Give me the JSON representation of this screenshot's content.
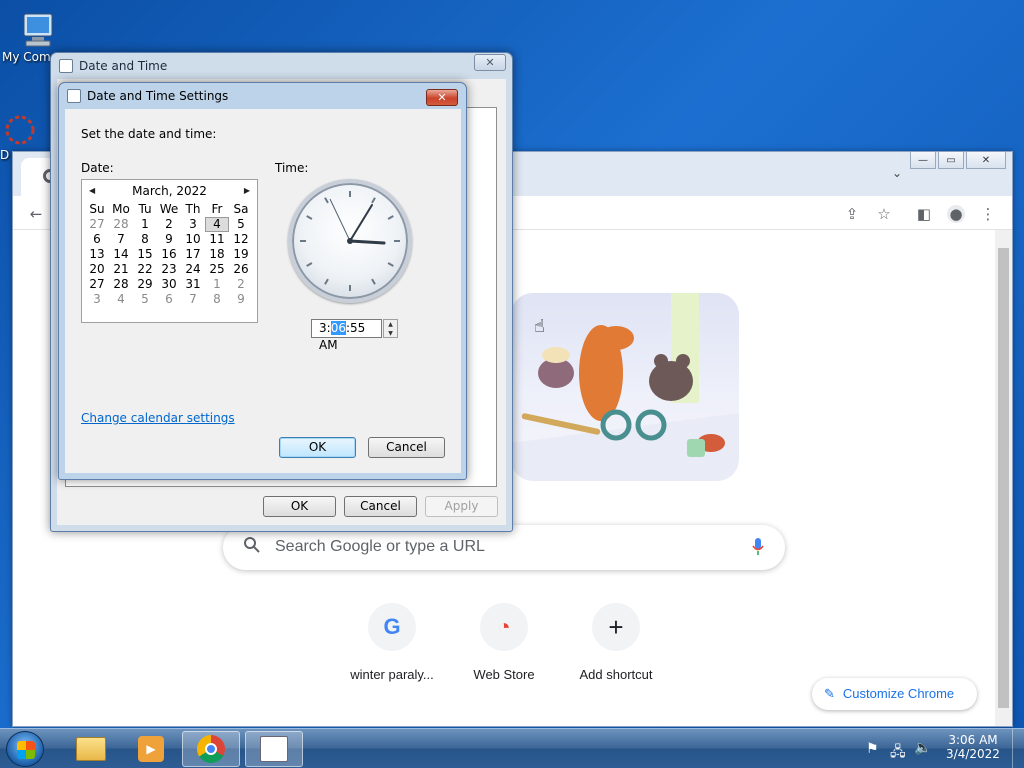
{
  "desktop": {
    "icons": [
      {
        "label": "My Comp"
      },
      {
        "label": "D"
      }
    ]
  },
  "chrome": {
    "search_placeholder": "Search Google or type a URL",
    "shortcuts": [
      {
        "label": "winter paraly...",
        "glyph": "G"
      },
      {
        "label": "Web Store",
        "glyph": "◔"
      },
      {
        "label": "Add shortcut",
        "glyph": "+"
      }
    ],
    "customize_label": "Customize Chrome",
    "customize_glyph": "✎"
  },
  "outer_dialog": {
    "title": "Date and Time",
    "ok_label": "OK",
    "cancel_label": "Cancel",
    "apply_label": "Apply"
  },
  "inner_dialog": {
    "title": "Date and Time Settings",
    "instruction": "Set the date and time:",
    "date_label": "Date:",
    "time_label": "Time:",
    "calendar": {
      "month_label": "March, 2022",
      "prev_glyph": "◀",
      "next_glyph": "▶",
      "weekdays": [
        "Su",
        "Mo",
        "Tu",
        "We",
        "Th",
        "Fr",
        "Sa"
      ],
      "days": [
        "27",
        "28",
        "1",
        "2",
        "3",
        "4",
        "5",
        "6",
        "7",
        "8",
        "9",
        "10",
        "11",
        "12",
        "13",
        "14",
        "15",
        "16",
        "17",
        "18",
        "19",
        "20",
        "21",
        "22",
        "23",
        "24",
        "25",
        "26",
        "27",
        "28",
        "29",
        "30",
        "31",
        "1",
        "2",
        "3",
        "4",
        "5",
        "6",
        "7",
        "8",
        "9"
      ],
      "selected_day": "4"
    },
    "time_value": {
      "hour": "3",
      "sep1": ":",
      "minute": "06",
      "rest": ":55 AM"
    },
    "change_calendar_link": "Change calendar settings",
    "ok_label": "OK",
    "cancel_label": "Cancel"
  },
  "taskbar": {
    "clock_time": "3:06 AM",
    "clock_date": "3/4/2022"
  }
}
